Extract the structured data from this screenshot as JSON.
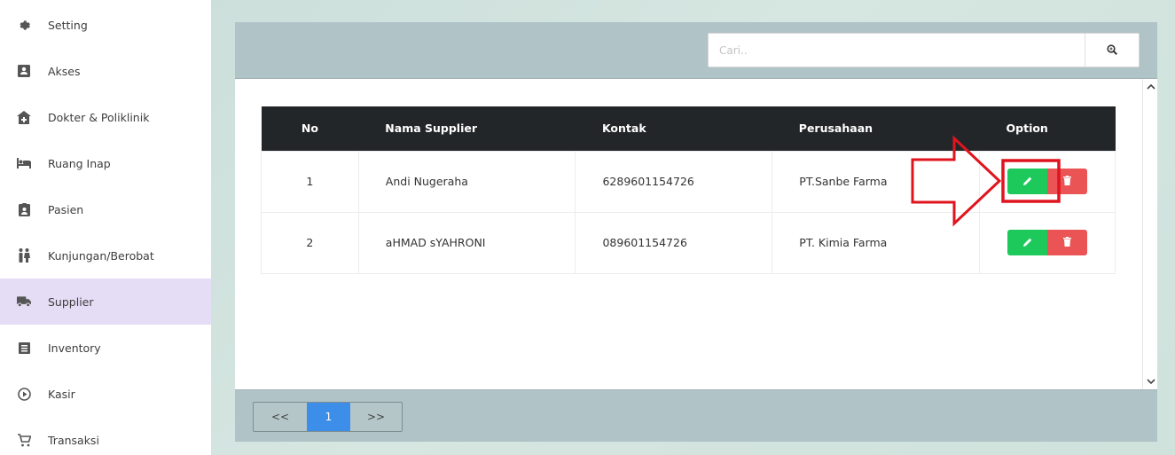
{
  "sidebar": {
    "items": [
      {
        "label": "Setting",
        "icon": "gear-icon"
      },
      {
        "label": "Akses",
        "icon": "id-card-icon"
      },
      {
        "label": "Dokter & Poliklinik",
        "icon": "clinic-icon"
      },
      {
        "label": "Ruang Inap",
        "icon": "bed-icon"
      },
      {
        "label": "Pasien",
        "icon": "patient-icon"
      },
      {
        "label": "Kunjungan/Berobat",
        "icon": "people-icon"
      },
      {
        "label": "Supplier",
        "icon": "truck-icon",
        "active": true
      },
      {
        "label": "Inventory",
        "icon": "list-icon"
      },
      {
        "label": "Kasir",
        "icon": "play-circle-icon"
      },
      {
        "label": "Transaksi",
        "icon": "cart-icon"
      }
    ]
  },
  "search": {
    "placeholder": "Cari..",
    "value": ""
  },
  "table": {
    "headers": {
      "no": "No",
      "name": "Nama Supplier",
      "kontak": "Kontak",
      "perusahaan": "Perusahaan",
      "option": "Option"
    },
    "rows": [
      {
        "no": "1",
        "name": "Andi Nugeraha",
        "kontak": "6289601154726",
        "perusahaan": "PT.Sanbe Farma"
      },
      {
        "no": "2",
        "name": "aHMAD sYAHRONI",
        "kontak": "089601154726",
        "perusahaan": "PT. Kimia Farma"
      }
    ]
  },
  "pagination": {
    "prev": "<<",
    "current": "1",
    "next": ">>"
  },
  "colors": {
    "active_bg": "#e5dcf5",
    "edit": "#1ec95c",
    "delete": "#ea5455",
    "page_active": "#3d8ee8",
    "annotation": "#e0141e"
  }
}
